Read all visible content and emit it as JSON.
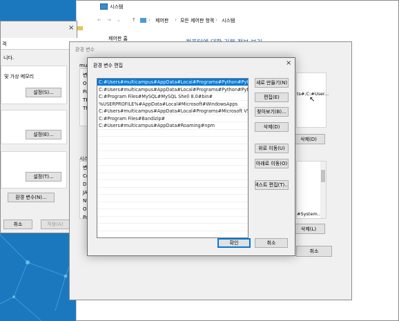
{
  "system_window": {
    "title": "시스템",
    "breadcrumb": [
      "제어판",
      "모든 제어판 항목",
      "시스템"
    ],
    "sidebar_link": "제어판 홈",
    "heading": "컴퓨터에 대한 기본 정보 보기"
  },
  "system_properties": {
    "tab_fragment": "격",
    "line1": "니다.",
    "line2": "및 가상 메모리",
    "settings1": "설정(S)...",
    "settings2": "설정(E)...",
    "settings3": "설정(T)...",
    "env_button": "환경 변수(N)...",
    "cancel": "취소",
    "apply": "적용(A)"
  },
  "env_dialog": {
    "title": "환경 변수",
    "user_section_fragment": "mult",
    "user_list_col_fragment": "변",
    "user_list_rows": [
      "O",
      "Pa",
      "TE",
      "TM"
    ],
    "user_path_value_fragment": "ts#;C:#User...",
    "user_delete": "삭제(D)",
    "sys_section_fragment": "시스",
    "sys_list_col_fragment": "변",
    "sys_list_rows": [
      "Co",
      "Dr",
      "JA",
      "NU",
      "OS",
      "Pa"
    ],
    "sys_value_fragment": "#System...",
    "sys_delete": "삭제(L)",
    "cancel": "취소"
  },
  "edit_dialog": {
    "title": "환경 변수 편집",
    "paths": [
      "C:#Users#multicampus#AppData#Local#Programs#Python#Pytho...",
      "C:#Users#multicampus#AppData#Local#Programs#Python#Pytho...",
      "C:#Program Files#MySQL#MySQL Shell 8.0#bin#",
      "%USERPROFILE%#AppData#Local#Microsoft#WindowsApps",
      "C:#Users#multicampus#AppData#Local#Programs#Microsoft VS C...",
      "C:#Program Files#Bandizip#",
      "C:#Users#multicampus#AppData#Roaming#npm"
    ],
    "buttons": {
      "new": "새로 만들기(N)",
      "edit": "편집(E)",
      "browse": "찾아보기(B)...",
      "delete": "삭제(D)",
      "move_up": "위로 이동(U)",
      "move_down": "아래로 이동(O)",
      "edit_text": "텍스트 편집(T)...",
      "ok": "확인",
      "cancel": "취소"
    }
  }
}
